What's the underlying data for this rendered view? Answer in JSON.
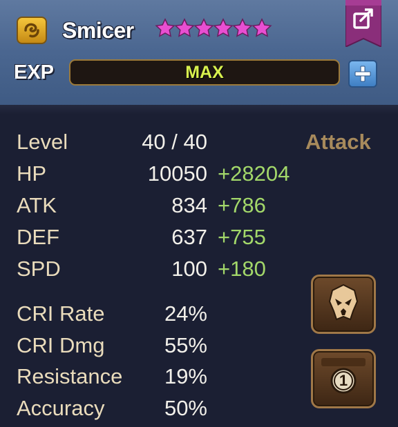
{
  "monster": {
    "name": "Smicer",
    "star_count": 6,
    "element_icon": "wind-element-icon",
    "colors": {
      "star": "#e84fd2",
      "element": "#f1b51f"
    }
  },
  "exp": {
    "label": "EXP",
    "value": "MAX"
  },
  "attack_type": "Attack",
  "stats": [
    {
      "label": "Level",
      "base": "40 / 40",
      "bonus": ""
    },
    {
      "label": "HP",
      "base": "10050",
      "bonus": "+28204"
    },
    {
      "label": "ATK",
      "base": "834",
      "bonus": "+786"
    },
    {
      "label": "DEF",
      "base": "637",
      "bonus": "+755"
    },
    {
      "label": "SPD",
      "base": "100",
      "bonus": "+180"
    }
  ],
  "sub_stats": [
    {
      "label": "CRI Rate",
      "value": "24%"
    },
    {
      "label": "CRI Dmg",
      "value": "55%"
    },
    {
      "label": "Resistance",
      "value": "19%"
    },
    {
      "label": "Accuracy",
      "value": "50%"
    }
  ],
  "buttons": {
    "skill_number": "1",
    "icons": [
      "share-icon",
      "plus-icon",
      "monster-skull-icon",
      "numbered-skill-icon"
    ]
  }
}
